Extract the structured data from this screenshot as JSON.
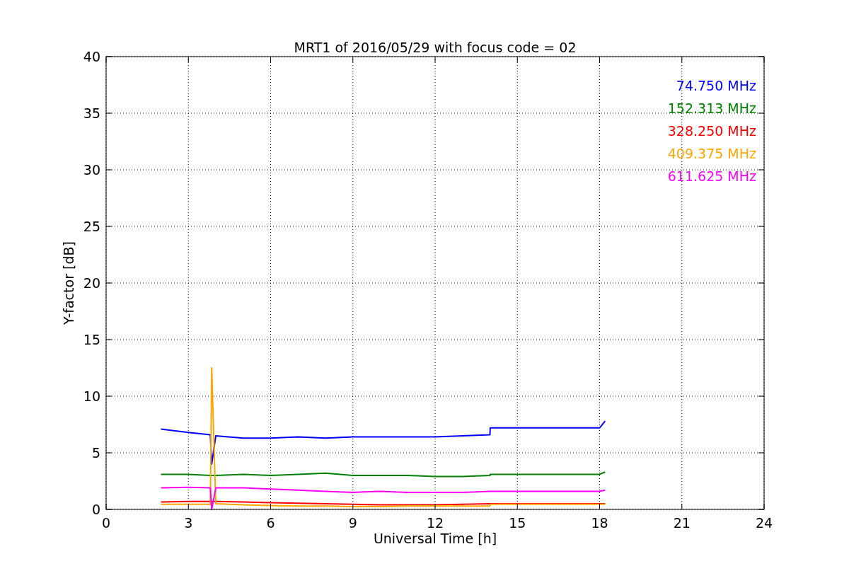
{
  "chart_data": {
    "type": "line",
    "title": "MRT1 of 2016/05/29 with focus code = 02",
    "xlabel": "Universal Time [h]",
    "ylabel": "Y-factor [dB]",
    "x": [
      2,
      3,
      3.8,
      3.85,
      4,
      5,
      6,
      7,
      8,
      9,
      10,
      11,
      12,
      13,
      14,
      14.01,
      18,
      18.2
    ],
    "series": [
      {
        "name": "74.750 MHz",
        "color": "#0000ff",
        "values": [
          7.1,
          6.8,
          6.6,
          4.0,
          6.5,
          6.3,
          6.3,
          6.4,
          6.3,
          6.4,
          6.4,
          6.4,
          6.4,
          6.5,
          6.6,
          7.2,
          7.2,
          7.8
        ]
      },
      {
        "name": "152.313 MHz",
        "color": "#008000",
        "values": [
          3.1,
          3.1,
          3.0,
          3.0,
          3.0,
          3.1,
          3.0,
          3.1,
          3.2,
          3.0,
          3.0,
          3.0,
          2.9,
          2.9,
          3.0,
          3.1,
          3.1,
          3.3
        ]
      },
      {
        "name": "328.250 MHz",
        "color": "#ff0000",
        "values": [
          0.65,
          0.7,
          0.7,
          0.7,
          0.7,
          0.65,
          0.6,
          0.55,
          0.5,
          0.45,
          0.4,
          0.4,
          0.4,
          0.45,
          0.5,
          0.5,
          0.5,
          0.5
        ]
      },
      {
        "name": "409.375 MHz",
        "color": "#ffa500",
        "values": [
          0.45,
          0.45,
          0.45,
          12.5,
          0.5,
          0.4,
          0.35,
          0.3,
          0.3,
          0.25,
          0.25,
          0.3,
          0.3,
          0.3,
          0.3,
          0.45,
          0.45,
          0.45
        ]
      },
      {
        "name": "611.625 MHz",
        "color": "#ff00ff",
        "values": [
          1.9,
          1.95,
          1.9,
          0,
          1.9,
          1.9,
          1.8,
          1.7,
          1.6,
          1.5,
          1.6,
          1.5,
          1.5,
          1.5,
          1.6,
          1.6,
          1.6,
          1.7
        ]
      }
    ],
    "xlim": [
      0,
      24
    ],
    "ylim": [
      0,
      40
    ],
    "xticks": [
      0,
      3,
      6,
      9,
      12,
      15,
      18,
      21,
      24
    ],
    "yticks": [
      0,
      5,
      10,
      15,
      20,
      25,
      30,
      35,
      40
    ],
    "grid": true
  }
}
